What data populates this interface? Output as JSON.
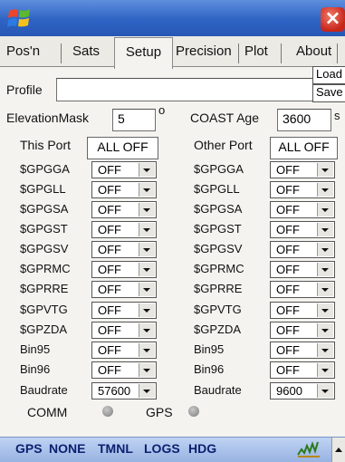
{
  "window": {
    "close_label": "×"
  },
  "tabs": [
    {
      "label": "Pos'n",
      "selected": false
    },
    {
      "label": "Sats",
      "selected": false
    },
    {
      "label": "Setup",
      "selected": true
    },
    {
      "label": "Precision",
      "selected": false
    },
    {
      "label": "Plot",
      "selected": false
    },
    {
      "label": "About",
      "selected": false
    }
  ],
  "profile": {
    "label": "Profile",
    "value": "",
    "load_label": "Load",
    "save_label": "Save"
  },
  "settings": {
    "elevation_label": "ElevationMask",
    "elevation_value": "5",
    "elevation_unit": "o",
    "coast_label": "COAST Age",
    "coast_value": "3600",
    "coast_unit": "s"
  },
  "this_port": {
    "title": "This Port",
    "all_off_label": "ALL OFF",
    "rows": [
      {
        "label": "$GPGGA",
        "value": "OFF"
      },
      {
        "label": "$GPGLL",
        "value": "OFF"
      },
      {
        "label": "$GPGSA",
        "value": "OFF"
      },
      {
        "label": "$GPGST",
        "value": "OFF"
      },
      {
        "label": "$GPGSV",
        "value": "OFF"
      },
      {
        "label": "$GPRMC",
        "value": "OFF"
      },
      {
        "label": "$GPRRE",
        "value": "OFF"
      },
      {
        "label": "$GPVTG",
        "value": "OFF"
      },
      {
        "label": "$GPZDA",
        "value": "OFF"
      },
      {
        "label": "Bin95",
        "value": "OFF"
      },
      {
        "label": "Bin96",
        "value": "OFF"
      },
      {
        "label": "Baudrate",
        "value": "57600"
      }
    ]
  },
  "other_port": {
    "title": "Other Port",
    "all_off_label": "ALL OFF",
    "rows": [
      {
        "label": "$GPGGA",
        "value": "OFF"
      },
      {
        "label": "$GPGLL",
        "value": "OFF"
      },
      {
        "label": "$GPGSA",
        "value": "OFF"
      },
      {
        "label": "$GPGST",
        "value": "OFF"
      },
      {
        "label": "$GPGSV",
        "value": "OFF"
      },
      {
        "label": "$GPRMC",
        "value": "OFF"
      },
      {
        "label": "$GPRRE",
        "value": "OFF"
      },
      {
        "label": "$GPVTG",
        "value": "OFF"
      },
      {
        "label": "$GPZDA",
        "value": "OFF"
      },
      {
        "label": "Bin95",
        "value": "OFF"
      },
      {
        "label": "Bin96",
        "value": "OFF"
      },
      {
        "label": "Baudrate",
        "value": "9600"
      }
    ]
  },
  "status": {
    "comm_label": "COMM",
    "gps_label": "GPS"
  },
  "bottom_bar": {
    "items": [
      "GPS",
      "NONE",
      "TMNL",
      "LOGS",
      "HDG"
    ]
  },
  "icons": {
    "start": "windows-logo-icon",
    "tray": "network-signal-icon"
  }
}
